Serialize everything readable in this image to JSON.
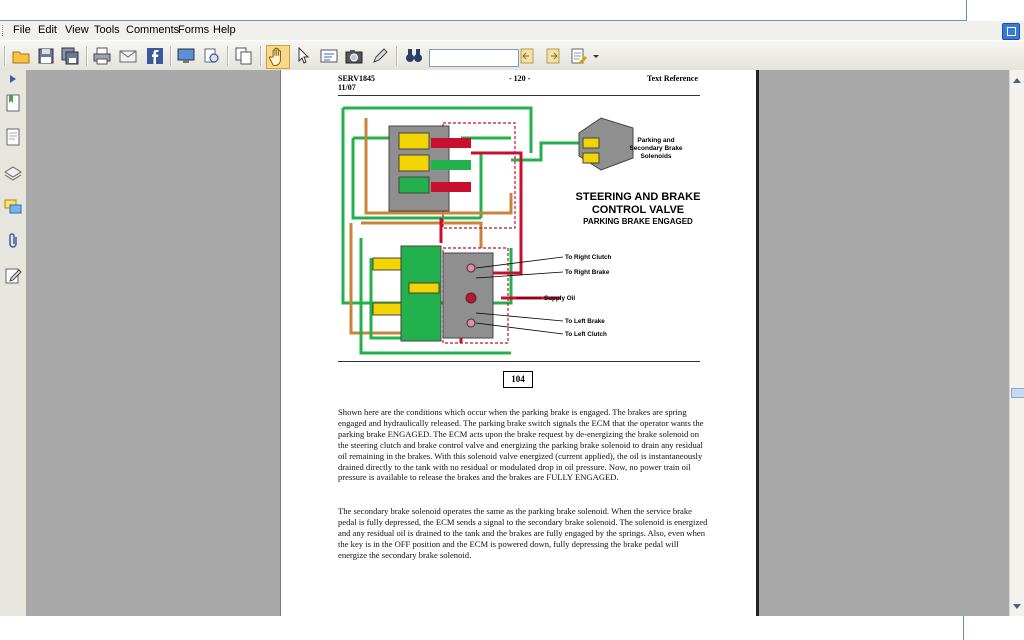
{
  "menu": [
    "File",
    "Edit",
    "View",
    "Tools",
    "Comments",
    "Forms",
    "Help"
  ],
  "toolbar": {
    "icons": [
      "open-folder",
      "save",
      "save-all",
      "print",
      "email",
      "facebook",
      "monitor",
      "print-preview",
      "pages",
      "hand-tool",
      "select-arrow",
      "text-select",
      "snapshot",
      "edit-pen",
      "find-binoculars",
      "find-prev",
      "find-next",
      "highlight"
    ],
    "search_value": ""
  },
  "sidepanel": {
    "icons": [
      "bookmarks",
      "pages",
      "layers",
      "comments",
      "attachments",
      "signatures"
    ]
  },
  "page": {
    "header_left_line1": "SERV1845",
    "header_left_line2": "11/07",
    "header_center": "- 120 -",
    "header_right": "Text Reference",
    "figure_number": "104",
    "diagram": {
      "title_line1": "STEERING AND BRAKE",
      "title_line2": "CONTROL VALVE",
      "subtitle": "PARKING BRAKE ENGAGED",
      "solenoid_label_1": "Parking and",
      "solenoid_label_2": "Secondary Brake",
      "solenoid_label_3": "Solenoids",
      "callouts": [
        "To Right Clutch",
        "To Right Brake",
        "Supply Oil",
        "To Left Brake",
        "To Left Clutch"
      ]
    },
    "paragraph1": "Shown here are the conditions which occur when the parking brake is engaged.  The brakes are spring engaged and hydraulically released.  The parking brake switch signals the ECM that the operator wants the parking brake ENGAGED.  The ECM acts upon the brake request by de-energizing the brake solenoid on the steering clutch and brake control valve and energizing the parking brake solenoid to drain any residual oil remaining in the brakes.  With this solenoid valve energized (current applied), the oil is instantaneously drained directly to the tank with no residual or modulated drop in oil pressure.  Now, no power train oil pressure is available to release the brakes and the brakes are FULLY ENGAGED.",
    "paragraph2": "The secondary brake solenoid operates the same as the parking brake solenoid.  When the service brake pedal is fully depressed, the ECM sends a signal to the secondary brake solenoid. The solenoid is energized and any residual oil is drained to the tank and the brakes are fully engaged by the springs.  Also, even when the key is in the OFF position and the ECM is powered down, fully depressing the brake pedal will energize the secondary brake solenoid."
  },
  "colors": {
    "oil_green": "#22b14c",
    "supply_red": "#c8102e",
    "tank_orange": "#c8843a",
    "solenoid_yellow": "#f2d400"
  }
}
